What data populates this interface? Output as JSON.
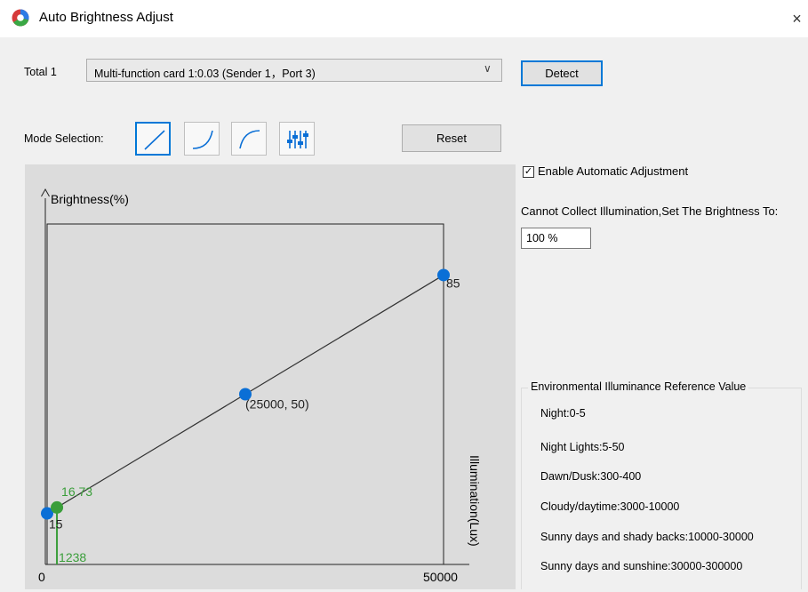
{
  "window": {
    "title": "Auto Brightness Adjust",
    "close_glyph": "×"
  },
  "device": {
    "total_label": "Total 1",
    "selected_card": "Multi-function card 1:0.03 (Sender 1，Port 3)",
    "detect_label": "Detect"
  },
  "mode": {
    "label": "Mode Selection:",
    "modes": [
      "linear-curve-icon",
      "concave-curve-icon",
      "convex-curve-icon",
      "custom-sliders-icon"
    ],
    "selected_index": 0,
    "reset_label": "Reset"
  },
  "settings": {
    "enable_label": "Enable Automatic Adjustment",
    "enable_checked": true,
    "fallback_label": "Cannot Collect Illumination,Set The Brightness To:",
    "fallback_value": "100 %"
  },
  "reference": {
    "title": "Environmental Illuminance Reference Value",
    "items": [
      "Night:0-5",
      "Night Lights:5-50",
      "Dawn/Dusk:300-400",
      "Cloudy/daytime:3000-10000",
      "Sunny days and shady backs:10000-30000",
      "Sunny days and sunshine:30000-300000"
    ]
  },
  "chart_data": {
    "type": "line",
    "ylabel": "Brightness(%)",
    "xlabel": "Illumination(Lux)",
    "xlim": [
      0,
      50000
    ],
    "ylim": [
      0,
      100
    ],
    "x_tick_labels": [
      "0",
      "50000"
    ],
    "series": [
      {
        "color": "#0a6fd6",
        "points": [
          {
            "x": 0,
            "y": 15,
            "label": "15"
          },
          {
            "x": 25000,
            "y": 50,
            "label": "(25000, 50)"
          },
          {
            "x": 50000,
            "y": 85,
            "label": "85"
          }
        ]
      },
      {
        "color": "#3a9e3a",
        "points": [
          {
            "x": 1238,
            "y": 16.73,
            "label": "16.73",
            "x_label": "1238"
          }
        ]
      }
    ]
  }
}
